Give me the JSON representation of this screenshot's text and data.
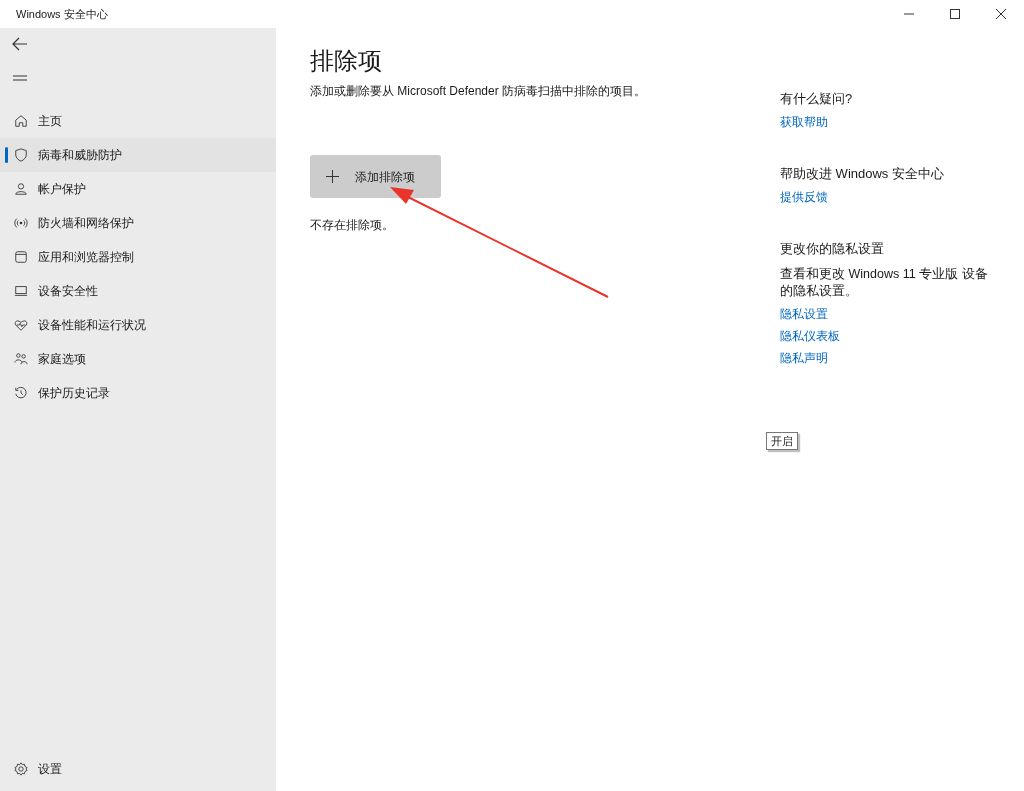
{
  "window": {
    "title": "Windows 安全中心"
  },
  "sidebar": {
    "items": [
      {
        "label": "主页",
        "selected": false
      },
      {
        "label": "病毒和威胁防护",
        "selected": true
      },
      {
        "label": "帐户保护",
        "selected": false
      },
      {
        "label": "防火墙和网络保护",
        "selected": false
      },
      {
        "label": "应用和浏览器控制",
        "selected": false
      },
      {
        "label": "设备安全性",
        "selected": false
      },
      {
        "label": "设备性能和运行状况",
        "selected": false
      },
      {
        "label": "家庭选项",
        "selected": false
      },
      {
        "label": "保护历史记录",
        "selected": false
      }
    ],
    "settings": "设置"
  },
  "main": {
    "title": "排除项",
    "description": "添加或删除要从 Microsoft Defender 防病毒扫描中排除的项目。",
    "add_button": "添加排除项",
    "empty_text": "不存在排除项。"
  },
  "aside": [
    {
      "heading": "有什么疑问?",
      "links": [
        "获取帮助"
      ]
    },
    {
      "heading": "帮助改进 Windows 安全中心",
      "links": [
        "提供反馈"
      ]
    },
    {
      "heading": "更改你的隐私设置",
      "text": "查看和更改 Windows 11 专业版 设备的隐私设置。",
      "links": [
        "隐私设置",
        "隐私仪表板",
        "隐私声明"
      ]
    }
  ],
  "tooltip": "开启"
}
